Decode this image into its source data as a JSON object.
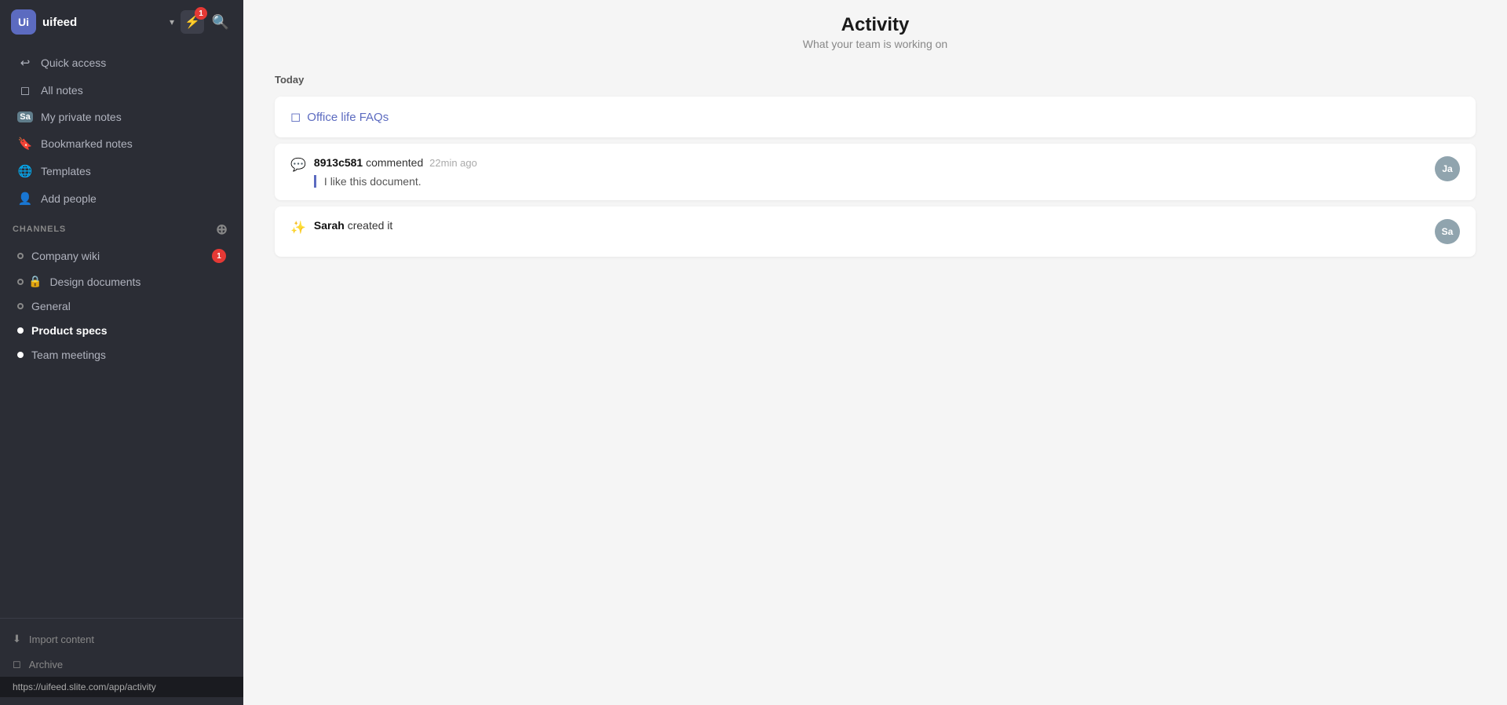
{
  "sidebar": {
    "workspace_avatar": "Ui",
    "workspace_name": "uifeed",
    "notification_count": "1",
    "nav_items": [
      {
        "id": "quick-access",
        "label": "Quick access",
        "icon": "↩"
      },
      {
        "id": "all-notes",
        "label": "All notes",
        "icon": "📄"
      },
      {
        "id": "my-private-notes",
        "label": "My private notes",
        "icon": "Sa"
      },
      {
        "id": "bookmarked-notes",
        "label": "Bookmarked notes",
        "icon": "🔖"
      },
      {
        "id": "templates",
        "label": "Templates",
        "icon": "🌐"
      },
      {
        "id": "add-people",
        "label": "Add people",
        "icon": "👤"
      }
    ],
    "channels_label": "CHANNELS",
    "channels": [
      {
        "id": "company-wiki",
        "label": "Company wiki",
        "badge": "1",
        "dot": "outline"
      },
      {
        "id": "design-documents",
        "label": "Design documents",
        "dot": "outline",
        "lock": true
      },
      {
        "id": "general",
        "label": "General",
        "dot": "outline"
      },
      {
        "id": "product-specs",
        "label": "Product specs",
        "dot": "filled",
        "active": true
      },
      {
        "id": "team-meetings",
        "label": "Team meetings",
        "dot": "filled"
      }
    ],
    "footer": {
      "import_label": "Import content",
      "archive_label": "Archive"
    },
    "url": "https://uifeed.slite.com/app/activity"
  },
  "main": {
    "title": "Activity",
    "subtitle": "What your team is working on",
    "section_date": "Today",
    "activity_items": [
      {
        "type": "doc_link",
        "doc_name": "Office life FAQs"
      },
      {
        "type": "comment",
        "icon": "💬",
        "user": "8913c581",
        "action": "commented",
        "time": "22min ago",
        "quote": "I like this document.",
        "avatar_initials": "Ja",
        "avatar_class": "avatar-ja"
      },
      {
        "type": "created",
        "icon": "✨",
        "user": "Sarah",
        "action": "created it",
        "avatar_initials": "Sa",
        "avatar_class": "avatar-sa"
      }
    ]
  }
}
